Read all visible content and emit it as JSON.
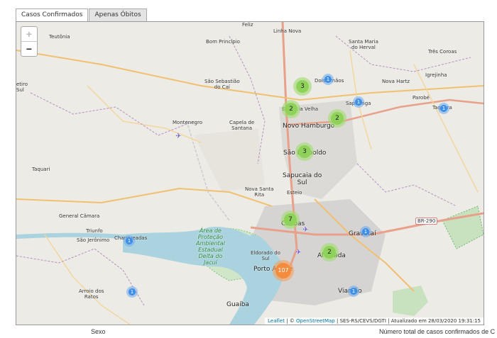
{
  "tabs": [
    {
      "label": "Casos Confirmados"
    },
    {
      "label": "Apenas Óbitos"
    }
  ],
  "map": {
    "zoom_in": "+",
    "zoom_out": "−",
    "places": {
      "teutonia": "Teutônia",
      "feliz": "Feliz",
      "linha_nova": "Linha Nova",
      "bom_principio": "Bom Princípio",
      "santa_maria_herval": "Santa Maria\ndo Herval",
      "tres_coroas": "Três Coroas",
      "retiro": "etiro\nSul",
      "sao_sebastiao": "São Sebastião\ndo Caí",
      "dois_irmaos": "Dois Irmãos",
      "nova_hartz": "Nova Hartz",
      "igrejinha": "Igrejinha",
      "parobe": "Parobé",
      "sapiranga": "Sapiranga",
      "taquara": "Taquara",
      "estancia_velha": "Estância Velha",
      "montenegro": "Montenegro",
      "capela": "Capela de\nSantana",
      "novo_hamburgo": "Novo Hamburgo",
      "sao_leopoldo": "São Leopoldo",
      "taquari": "Taquari",
      "sapucaia": "Sapucaia do\nSul",
      "nova_santa_rita": "Nova Santa\nRita",
      "esteio": "Esteio",
      "general_camara": "General Câmara",
      "canoas": "Canoas",
      "triunfo": "Triunfo",
      "charqueadas": "Charqueadas",
      "sao_jeronimo": "São Jerônimo",
      "gravatai": "Gravataí",
      "delta": "Área de\nProteção\nAmbiental\nEstadual\nDelta do\nJacuí",
      "eldorado": "Eldorado do\nSul",
      "alvorada": "Alvorada",
      "porto_alegre": "Porto Alegre",
      "arroio_ratos": "Arroio dos\nRatos",
      "viamao": "Viamão",
      "guaiba": "Guaíba",
      "br290": "BR-290"
    },
    "clusters": [
      {
        "id": "dois-irmaos",
        "count": "3"
      },
      {
        "id": "dois-irmaos-small",
        "count": "1"
      },
      {
        "id": "sapiranga",
        "count": "1"
      },
      {
        "id": "taquara",
        "count": "1"
      },
      {
        "id": "estancia-velha",
        "count": "2"
      },
      {
        "id": "novo-hamburgo",
        "count": "2"
      },
      {
        "id": "sao-leopoldo",
        "count": "3"
      },
      {
        "id": "canoas",
        "count": "7"
      },
      {
        "id": "charqueadas",
        "count": "1"
      },
      {
        "id": "gravatai",
        "count": "1"
      },
      {
        "id": "alvorada",
        "count": "2"
      },
      {
        "id": "porto-alegre",
        "count": "107"
      },
      {
        "id": "arroio",
        "count": "1"
      },
      {
        "id": "viamao",
        "count": "1"
      }
    ],
    "attribution": {
      "leaflet": "Leaflet",
      "sep1": " | © ",
      "osm": "OpenStreetMap",
      "rest": " | SES-RS/CEVS/DGTI | Atualizado em 28/03/2020 19:31:15"
    }
  },
  "footer": {
    "left": "Sexo",
    "right": "Número total de casos confirmados de C"
  }
}
